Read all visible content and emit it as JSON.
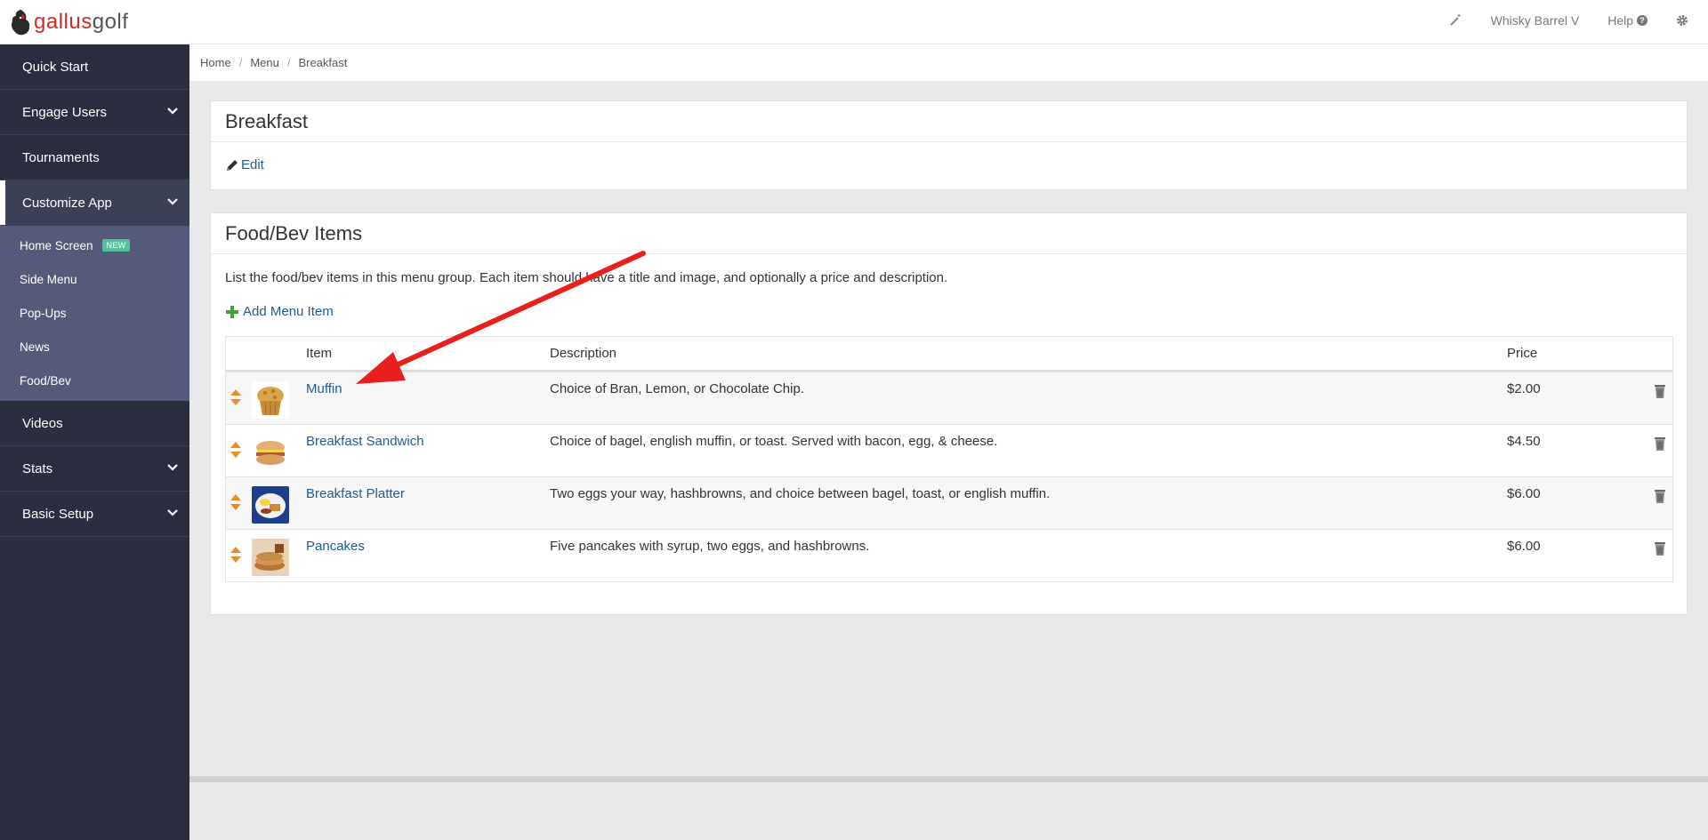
{
  "brand": {
    "part1": "gallus",
    "part2": "golf"
  },
  "topbar": {
    "course": "Whisky Barrel V",
    "help": "Help",
    "help_icon": "?"
  },
  "sidebar": {
    "items": [
      {
        "label": "Quick Start"
      },
      {
        "label": "Engage Users"
      },
      {
        "label": "Tournaments"
      },
      {
        "label": "Customize App"
      },
      {
        "label": "Videos"
      },
      {
        "label": "Stats"
      },
      {
        "label": "Basic Setup"
      }
    ],
    "subitems": [
      {
        "label": "Home Screen",
        "badge": "NEW"
      },
      {
        "label": "Side Menu"
      },
      {
        "label": "Pop-Ups"
      },
      {
        "label": "News"
      },
      {
        "label": "Food/Bev"
      }
    ]
  },
  "breadcrumb": [
    "Home",
    "Menu",
    "Breakfast"
  ],
  "group_panel": {
    "title": "Breakfast",
    "edit_label": "Edit"
  },
  "items_panel": {
    "title": "Food/Bev Items",
    "description": "List the food/bev items in this menu group. Each item should have a title and image, and optionally a price and description.",
    "add_label": "Add Menu Item",
    "columns": {
      "item": "Item",
      "description": "Description",
      "price": "Price"
    },
    "rows": [
      {
        "name": "Muffin",
        "description": "Choice of Bran, Lemon, or Chocolate Chip.",
        "price": "$2.00"
      },
      {
        "name": "Breakfast Sandwich",
        "description": "Choice of bagel, english muffin, or toast. Served with bacon, egg, & cheese.",
        "price": "$4.50"
      },
      {
        "name": "Breakfast Platter",
        "description": "Two eggs your way, hashbrowns, and choice between bagel, toast, or english muffin.",
        "price": "$6.00"
      },
      {
        "name": "Pancakes",
        "description": "Five pancakes with syrup, two eggs, and hashbrowns.",
        "price": "$6.00"
      }
    ]
  },
  "colors": {
    "sidebar": "#2a2e3f",
    "subnav": "#535a7a",
    "link": "#1f5b8c",
    "brand_red": "#d12a2a",
    "annotation": "#e8201c"
  }
}
